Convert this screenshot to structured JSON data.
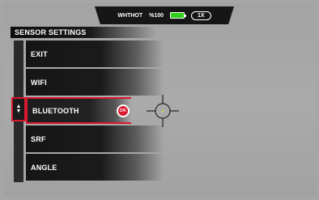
{
  "status_bar": {
    "device_name": "WHTHOT",
    "battery_text": "%100",
    "battery_color": "#2fd11a",
    "zoom_label": "1X"
  },
  "menu": {
    "title": "SENSOR SETTINGS",
    "selected_index": 2,
    "ok_label": "OK",
    "accent_color": "#d61a2f",
    "items": [
      {
        "label": "EXIT"
      },
      {
        "label": "WIFI"
      },
      {
        "label": "BLUETOOTH"
      },
      {
        "label": "SRF"
      },
      {
        "label": "ANGLE"
      }
    ]
  },
  "icons": {
    "scroll": "up-down-arrows-icon",
    "reticle": "crosshair-icon",
    "battery": "battery-icon"
  }
}
